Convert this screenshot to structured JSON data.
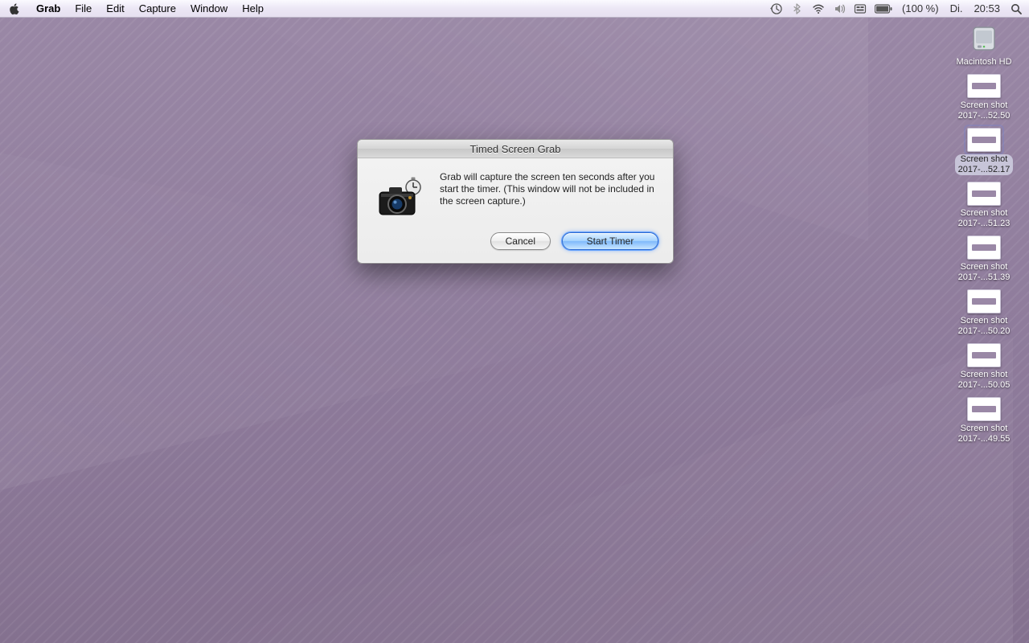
{
  "menubar": {
    "app": "Grab",
    "items": [
      "File",
      "Edit",
      "Capture",
      "Window",
      "Help"
    ],
    "battery": "(100 %)",
    "day": "Di.",
    "time": "20:53"
  },
  "dialog": {
    "title": "Timed Screen Grab",
    "message": "Grab will capture the screen ten seconds after you start the timer.  (This window will not be included in the screen capture.)",
    "cancel": "Cancel",
    "start": "Start Timer"
  },
  "desktop_icons": [
    {
      "name": "Macintosh HD",
      "sub": "",
      "type": "hd",
      "selected": false
    },
    {
      "name": "Screen shot",
      "sub": "2017-...52.50",
      "type": "doc",
      "selected": false
    },
    {
      "name": "Screen shot",
      "sub": "2017-...52.17",
      "type": "doc",
      "selected": true
    },
    {
      "name": "Screen shot",
      "sub": "2017-...51.23",
      "type": "doc",
      "selected": false
    },
    {
      "name": "Screen shot",
      "sub": "2017-...51.39",
      "type": "doc",
      "selected": false
    },
    {
      "name": "Screen shot",
      "sub": "2017-...50.20",
      "type": "doc",
      "selected": false
    },
    {
      "name": "Screen shot",
      "sub": "2017-...50.05",
      "type": "doc",
      "selected": false
    },
    {
      "name": "Screen shot",
      "sub": "2017-...49.55",
      "type": "doc",
      "selected": false
    }
  ]
}
